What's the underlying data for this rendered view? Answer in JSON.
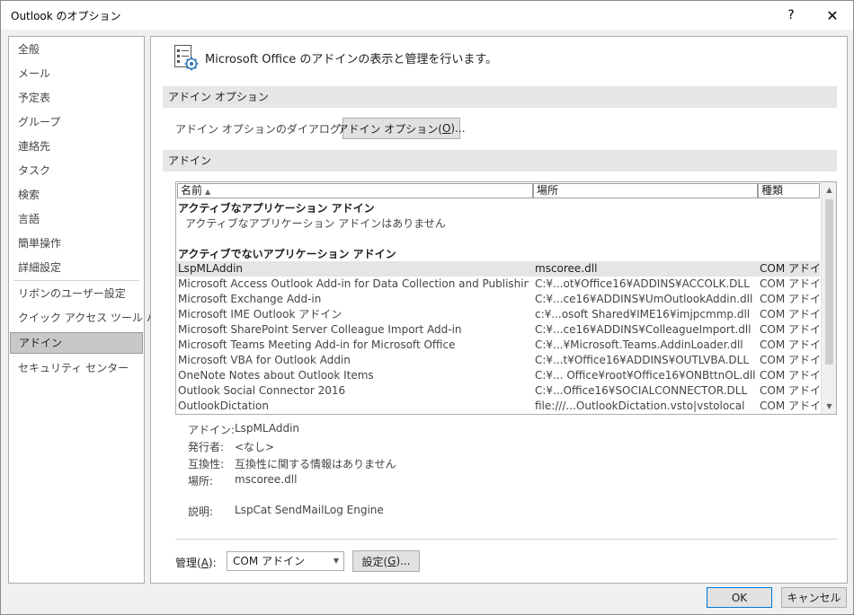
{
  "window": {
    "title": "Outlook のオプション",
    "help": "?",
    "close": "✕"
  },
  "nav": {
    "items": [
      {
        "label": "全般"
      },
      {
        "label": "メール"
      },
      {
        "label": "予定表"
      },
      {
        "label": "グループ"
      },
      {
        "label": "連絡先"
      },
      {
        "label": "タスク"
      },
      {
        "label": "検索"
      },
      {
        "label": "言語"
      },
      {
        "label": "簡単操作"
      },
      {
        "label": "詳細設定"
      },
      {
        "label": "リボンのユーザー設定"
      },
      {
        "label": "クイック アクセス ツール バー"
      },
      {
        "label": "アドイン",
        "selected": true
      },
      {
        "label": "セキュリティ センター"
      }
    ]
  },
  "main": {
    "header": "Microsoft Office のアドインの表示と管理を行います。",
    "addin_options_section": "アドイン オプション",
    "addin_options_label": "アドイン オプションのダイアログの起動:",
    "addin_options_button": "アドイン オプション(",
    "addin_options_button_key": "O",
    "addin_options_button_suffix": ")...",
    "addins_section": "アドイン",
    "columns": [
      "名前",
      "場所",
      "種類"
    ],
    "sort_indicator": "▲",
    "active_group": "アクティブなアプリケーション アドイン",
    "active_empty": "アクティブなアプリケーション アドインはありません",
    "inactive_group": "アクティブでないアプリケーション アドイン",
    "rows": [
      {
        "name": "LspMLAddin",
        "location": "mscoree.dll",
        "type": "COM アドイン"
      },
      {
        "name": "Microsoft Access Outlook Add-in for Data Collection and Publishing",
        "location": "C:¥...ot¥Office16¥ADDINS¥ACCOLK.DLL",
        "type": "COM アドイン"
      },
      {
        "name": "Microsoft Exchange Add-in",
        "location": "C:¥...ce16¥ADDINS¥UmOutlookAddin.dll",
        "type": "COM アドイン"
      },
      {
        "name": "Microsoft IME Outlook アドイン",
        "location": "c:¥...osoft Shared¥IME16¥imjpcmmp.dll",
        "type": "COM アドイン"
      },
      {
        "name": "Microsoft SharePoint Server Colleague Import Add-in",
        "location": "C:¥...ce16¥ADDINS¥ColleagueImport.dll",
        "type": "COM アドイン"
      },
      {
        "name": "Microsoft Teams Meeting Add-in for Microsoft Office",
        "location": "C:¥...¥Microsoft.Teams.AddinLoader.dll",
        "type": "COM アドイン"
      },
      {
        "name": "Microsoft VBA for Outlook Addin",
        "location": "C:¥...t¥Office16¥ADDINS¥OUTLVBA.DLL",
        "type": "COM アドイン"
      },
      {
        "name": "OneNote Notes about Outlook Items",
        "location": "C:¥... Office¥root¥Office16¥ONBttnOL.dll",
        "type": "COM アドイン"
      },
      {
        "name": "Outlook Social Connector 2016",
        "location": "C:¥...Office16¥SOCIALCONNECTOR.DLL",
        "type": "COM アドイン"
      },
      {
        "name": "OutlookDictation",
        "location": "file:///...OutlookDictation.vsto|vstolocal",
        "type": "COM アドイン"
      }
    ],
    "details": {
      "addin_label": "アドイン:",
      "addin_value": "LspMLAddin",
      "publisher_label": "発行者:",
      "publisher_value": "<なし>",
      "compat_label": "互換性:",
      "compat_value": "互換性に関する情報はありません",
      "location_label": "場所:",
      "location_value": "mscoree.dll",
      "desc_label": "説明:",
      "desc_value": "LspCat SendMailLog Engine"
    },
    "manage_label": "管理(",
    "manage_key": "A",
    "manage_suffix": "):",
    "manage_value": "COM アドイン",
    "settings_button": "設定(",
    "settings_key": "G",
    "settings_suffix": ")..."
  },
  "footer": {
    "ok": "OK",
    "cancel": "キャンセル"
  }
}
